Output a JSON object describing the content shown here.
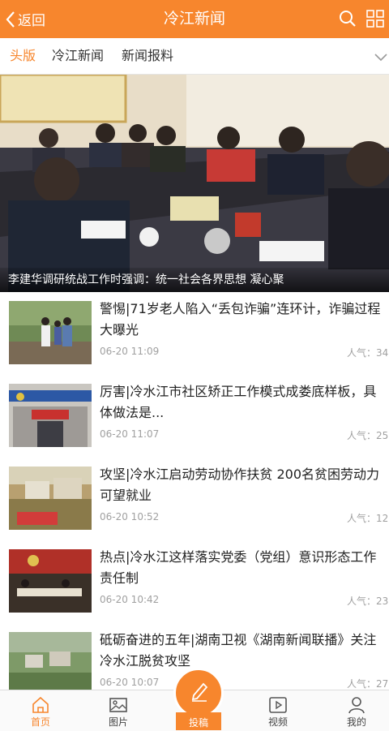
{
  "topbar": {
    "back_label": "返回",
    "title": "冷江新闻",
    "color": "#f7862d"
  },
  "tabs": [
    {
      "label": "头版",
      "active": true
    },
    {
      "label": "冷江新闻",
      "active": false
    },
    {
      "label": "新闻报料",
      "active": false
    }
  ],
  "hero": {
    "caption": "李建华调研统战工作时强调：统一社会各界思想 凝心聚"
  },
  "news": [
    {
      "headline": "警惕|71岁老人陷入“丢包诈骗”连环计，诈骗过程大曝光",
      "date": "06-20 11:09",
      "popularity": "人气：34"
    },
    {
      "headline": "厉害|冷水江市社区矫正工作模式成娄底样板，具体做法是...",
      "date": "06-20 11:07",
      "popularity": "人气：25"
    },
    {
      "headline": "攻坚|冷水江启动劳动协作扶贫 200名贫困劳动力可望就业",
      "date": "06-20 10:52",
      "popularity": "人气：12"
    },
    {
      "headline": "热点|冷水江这样落实党委（党组）意识形态工作责任制",
      "date": "06-20 10:42",
      "popularity": "人气：23"
    },
    {
      "headline": "砥砺奋进的五年|湖南卫视《湖南新闻联播》关注冷水江脱贫攻坚",
      "date": "06-20 10:07",
      "popularity": "人气：27"
    }
  ],
  "bottom_nav": [
    {
      "label": "首页",
      "icon": "home-icon",
      "active": true
    },
    {
      "label": "图片",
      "icon": "image-icon",
      "active": false
    },
    {
      "label": "投稿",
      "icon": "pencil-icon",
      "active": false
    },
    {
      "label": "视频",
      "icon": "video-icon",
      "active": false
    },
    {
      "label": "我的",
      "icon": "user-icon",
      "active": false
    }
  ]
}
